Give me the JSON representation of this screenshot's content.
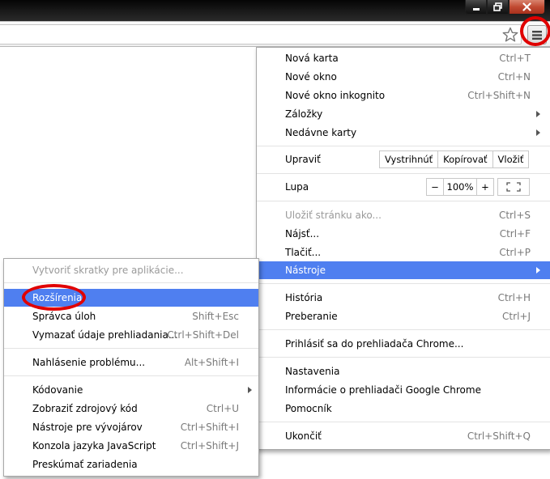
{
  "window": {
    "controls": {
      "minimize": "minimize-icon",
      "maximize": "restore-icon",
      "close": "close-icon"
    },
    "toolbar": {
      "bookmark_star": "star-icon",
      "menu_button": "hamburger-icon"
    },
    "highlight_color": "#4f7ff0",
    "annotation_color": "#e00000"
  },
  "main_menu": {
    "new_tab": {
      "label": "Nová karta",
      "shortcut": "Ctrl+T"
    },
    "new_window": {
      "label": "Nové okno",
      "shortcut": "Ctrl+N"
    },
    "new_incognito": {
      "label": "Nové okno inkognito",
      "shortcut": "Ctrl+Shift+N"
    },
    "bookmarks": {
      "label": "Záložky"
    },
    "recent_tabs": {
      "label": "Nedávne karty"
    },
    "edit": {
      "label": "Upraviť",
      "cut": "Vystrihnúť",
      "copy": "Kopírovať",
      "paste": "Vložiť"
    },
    "zoom": {
      "label": "Lupa",
      "minus": "−",
      "value": "100%",
      "plus": "+"
    },
    "save_page": {
      "label": "Uložiť stránku ako...",
      "shortcut": "Ctrl+S"
    },
    "find": {
      "label": "Nájsť...",
      "shortcut": "Ctrl+F"
    },
    "print": {
      "label": "Tlačiť...",
      "shortcut": "Ctrl+P"
    },
    "tools": {
      "label": "Nástroje"
    },
    "history": {
      "label": "História",
      "shortcut": "Ctrl+H"
    },
    "downloads": {
      "label": "Preberanie",
      "shortcut": "Ctrl+J"
    },
    "sign_in": {
      "label": "Prihlásiť sa do prehliadača Chrome..."
    },
    "settings": {
      "label": "Nastavenia"
    },
    "about": {
      "label": "Informácie o prehliadači Google Chrome"
    },
    "help": {
      "label": "Pomocník"
    },
    "exit": {
      "label": "Ukončiť",
      "shortcut": "Ctrl+Shift+Q"
    }
  },
  "tools_submenu": {
    "create_shortcuts": {
      "label": "Vytvoriť skratky pre aplikácie..."
    },
    "extensions": {
      "label": "Rozšírenia"
    },
    "task_manager": {
      "label": "Správca úloh",
      "shortcut": "Shift+Esc"
    },
    "clear_data": {
      "label": "Vymazať údaje prehliadania...",
      "shortcut": "Ctrl+Shift+Del"
    },
    "report_issue": {
      "label": "Nahlásenie problému...",
      "shortcut": "Alt+Shift+I"
    },
    "encoding": {
      "label": "Kódovanie"
    },
    "view_source": {
      "label": "Zobraziť zdrojový kód",
      "shortcut": "Ctrl+U"
    },
    "dev_tools": {
      "label": "Nástroje pre vývojárov",
      "shortcut": "Ctrl+Shift+I"
    },
    "js_console": {
      "label": "Konzola jazyka JavaScript",
      "shortcut": "Ctrl+Shift+J"
    },
    "inspect_devices": {
      "label": "Preskúmať zariadenia"
    }
  }
}
